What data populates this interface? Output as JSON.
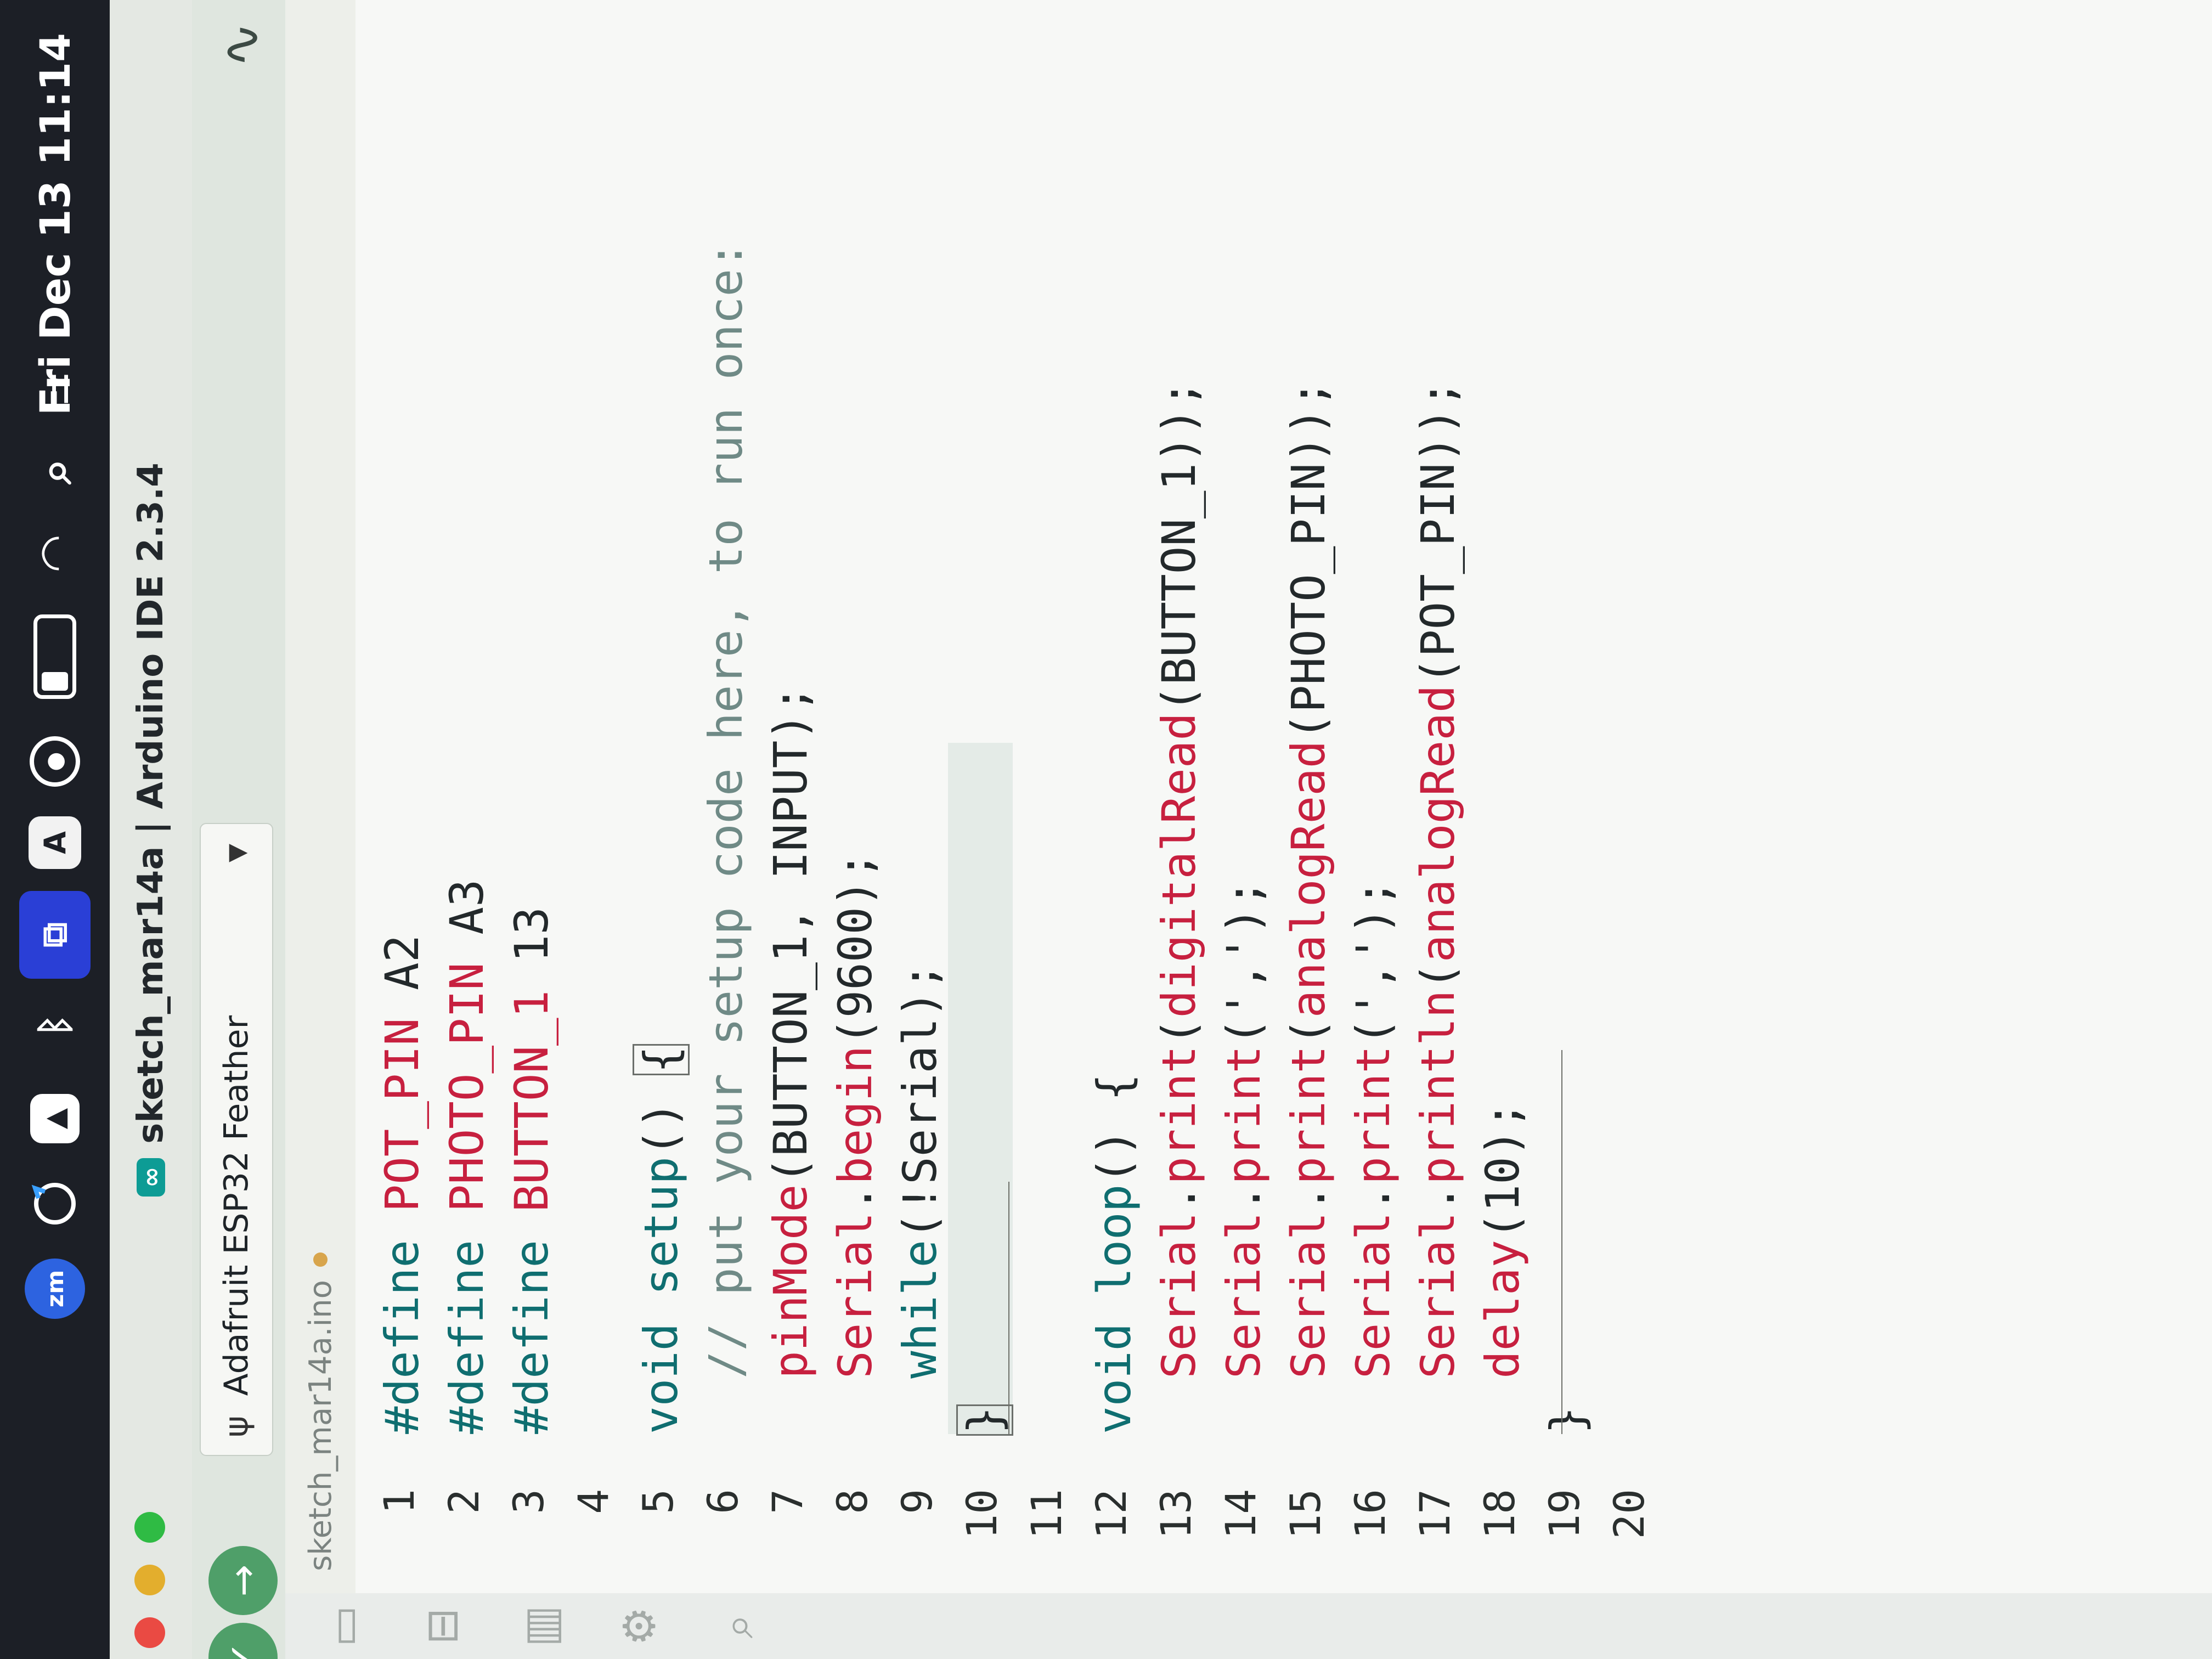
{
  "menubar": {
    "icons": [
      "zoom-icon",
      "sync-icon",
      "drive-icon",
      "bluetooth-icon",
      "copy-icon",
      "keyboard-icon",
      "user-icon",
      "battery-icon",
      "wifi-icon",
      "search-icon",
      "control-center-icon",
      "siri-icon"
    ],
    "zoom_text": "zm",
    "keyboard_text": "A",
    "clock": "Fri Dec 13  11:14"
  },
  "window": {
    "title": "sketch_mar14a | Arduino IDE 2.3.4"
  },
  "toolbar": {
    "board": "Adafruit ESP32 Feather"
  },
  "tab": {
    "filename": "sketch_mar14a.ino"
  },
  "editor": {
    "line_numbers": [
      "1",
      "2",
      "3",
      "4",
      "5",
      "6",
      "7",
      "8",
      "9",
      "10",
      "11",
      "12",
      "13",
      "14",
      "15",
      "16",
      "17",
      "18",
      "19",
      "20"
    ]
  },
  "colors": {
    "keyword": "#0f6e70",
    "function": "#c7203f",
    "comment": "#6f8a86",
    "accent": "#4f9f69",
    "menubar": "#1c1f26"
  }
}
